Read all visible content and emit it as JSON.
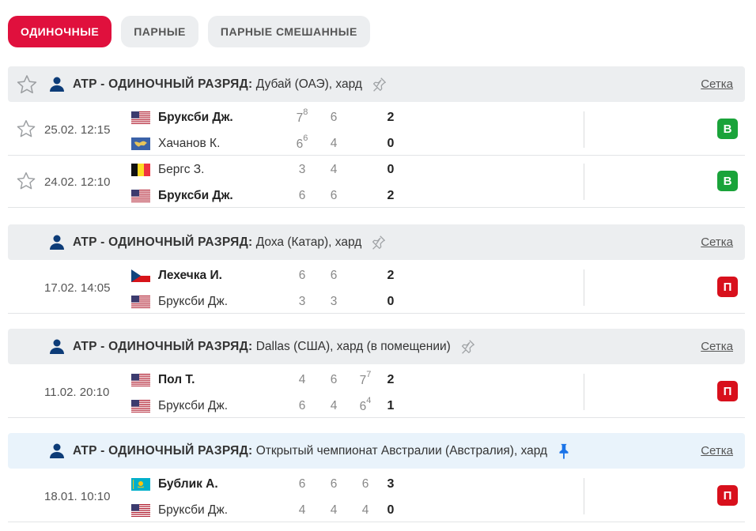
{
  "tabs": [
    "Одиночные",
    "Парные",
    "Парные смешанные"
  ],
  "bracket_label": "Сетка",
  "colors": {
    "accent": "#e0103d",
    "win": "#1aa33a",
    "loss": "#d8101c",
    "pinned_bg": "#e9f3fb"
  },
  "leagues": [
    {
      "category": "ATP - ОДИНОЧНЫЙ РАЗРЯД:",
      "tournament": "Дубай (ОАЭ), хард",
      "pinned": false,
      "matches": [
        {
          "time": "25.02. 12:15",
          "p1": {
            "name": "Бруксби Дж.",
            "flag": "usa",
            "score": "2",
            "sets": [
              "7",
              "6"
            ],
            "tb": [
              "8",
              ""
            ]
          },
          "p2": {
            "name": "Хачанов К.",
            "flag": "neutral",
            "score": "0",
            "sets": [
              "6",
              "4"
            ],
            "tb": [
              "6",
              ""
            ]
          },
          "winner": 1,
          "result": "В"
        },
        {
          "time": "24.02. 12:10",
          "p1": {
            "name": "Бергс З.",
            "flag": "belgium",
            "score": "0",
            "sets": [
              "3",
              "4"
            ],
            "tb": [
              "",
              ""
            ]
          },
          "p2": {
            "name": "Бруксби Дж.",
            "flag": "usa",
            "score": "2",
            "sets": [
              "6",
              "6"
            ],
            "tb": [
              "",
              ""
            ]
          },
          "winner": 2,
          "result": "В"
        }
      ]
    },
    {
      "category": "ATP - ОДИНОЧНЫЙ РАЗРЯД:",
      "tournament": "Доха (Катар), хард",
      "pinned": false,
      "matches": [
        {
          "time": "17.02. 14:05",
          "p1": {
            "name": "Лехечка И.",
            "flag": "czech",
            "score": "2",
            "sets": [
              "6",
              "6"
            ],
            "tb": [
              "",
              ""
            ]
          },
          "p2": {
            "name": "Бруксби Дж.",
            "flag": "usa",
            "score": "0",
            "sets": [
              "3",
              "3"
            ],
            "tb": [
              "",
              ""
            ]
          },
          "winner": 1,
          "result": "П"
        }
      ]
    },
    {
      "category": "ATP - ОДИНОЧНЫЙ РАЗРЯД:",
      "tournament": "Dallas (США), хард (в помещении)",
      "pinned": false,
      "matches": [
        {
          "time": "11.02. 20:10",
          "p1": {
            "name": "Пол Т.",
            "flag": "usa",
            "score": "2",
            "sets": [
              "4",
              "6",
              "7"
            ],
            "tb": [
              "",
              "",
              "7"
            ]
          },
          "p2": {
            "name": "Бруксби Дж.",
            "flag": "usa",
            "score": "1",
            "sets": [
              "6",
              "4",
              "6"
            ],
            "tb": [
              "",
              "",
              "4"
            ]
          },
          "winner": 1,
          "result": "П"
        }
      ]
    },
    {
      "category": "ATP - ОДИНОЧНЫЙ РАЗРЯД:",
      "tournament": "Открытый чемпионат Австралии (Австралия), хард",
      "pinned": true,
      "matches": [
        {
          "time": "18.01. 10:10",
          "p1": {
            "name": "Бублик А.",
            "flag": "kazakhstan",
            "score": "3",
            "sets": [
              "6",
              "6",
              "6"
            ],
            "tb": [
              "",
              "",
              ""
            ]
          },
          "p2": {
            "name": "Бруксби Дж.",
            "flag": "usa",
            "score": "0",
            "sets": [
              "4",
              "4",
              "4"
            ],
            "tb": [
              "",
              "",
              ""
            ]
          },
          "winner": 1,
          "result": "П"
        }
      ]
    }
  ]
}
